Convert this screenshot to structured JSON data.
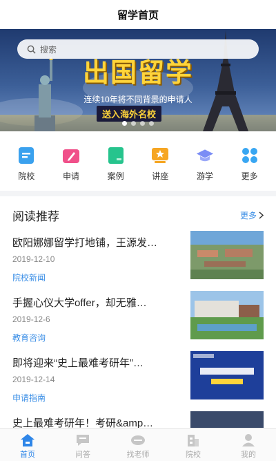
{
  "header": {
    "title": "留学首页"
  },
  "banner": {
    "search_placeholder": "搜索",
    "title": "出国留学",
    "subtitle": "连续10年将不同背景的申请人",
    "tagline": "送入海外名校",
    "dots": 4,
    "active_dot": 0
  },
  "grid": [
    {
      "label": "院校",
      "icon": "school-doc-icon",
      "color": "#3aa1ee"
    },
    {
      "label": "申请",
      "icon": "apply-pen-icon",
      "color": "#f0508a"
    },
    {
      "label": "案例",
      "icon": "case-book-icon",
      "color": "#26c48d"
    },
    {
      "label": "讲座",
      "icon": "lecture-star-icon",
      "color": "#f6a623"
    },
    {
      "label": "游学",
      "icon": "grad-cap-icon",
      "color": "#7b8df5"
    },
    {
      "label": "更多",
      "icon": "more-grid-icon",
      "color": "#38a6f2"
    }
  ],
  "reading": {
    "title": "阅读推荐",
    "more": "更多",
    "articles": [
      {
        "headline": "欧阳娜娜留学打地铺，王源发…",
        "date": "2019-12-10",
        "category": "院校新闻"
      },
      {
        "headline": "手握心仪大学offer，却无雅…",
        "date": "2019-12-6",
        "category": "教育咨询"
      },
      {
        "headline": "即将迎来“史上最难考研年”…",
        "date": "2019-12-14",
        "category": "申请指南"
      },
      {
        "headline": "史上最难考研年！考研&amp…",
        "date": "",
        "category": ""
      }
    ]
  },
  "tabbar": [
    {
      "label": "首页",
      "icon": "home-icon",
      "active": true
    },
    {
      "label": "问答",
      "icon": "chat-icon",
      "active": false
    },
    {
      "label": "找老师",
      "icon": "teacher-icon",
      "active": false
    },
    {
      "label": "院校",
      "icon": "building-icon",
      "active": false
    },
    {
      "label": "我的",
      "icon": "user-icon",
      "active": false
    }
  ],
  "colors": {
    "accent": "#2f86e8",
    "link": "#3a8ee6",
    "banner_title": "#ffd43a"
  }
}
